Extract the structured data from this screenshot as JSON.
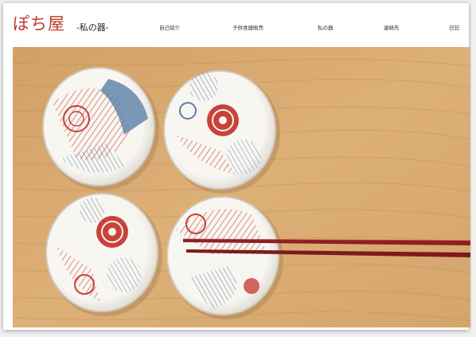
{
  "site": {
    "logo": "ぽち屋",
    "tagline": "-私の器-"
  },
  "nav": {
    "items": [
      {
        "label": "自己紹介"
      },
      {
        "label": "子供食器販売"
      },
      {
        "label": "私の器"
      },
      {
        "label": "連絡先"
      },
      {
        "label": "日記"
      }
    ]
  },
  "hero": {
    "description": "",
    "colors": {
      "wood": "#d8a86a",
      "porcelain": "#f6f3ee",
      "red_pattern": "#c8423a",
      "blue_pattern": "#5b7fa8",
      "chopsticks": "#8e1f22"
    }
  },
  "theme": {
    "accent": "#c0392b"
  }
}
